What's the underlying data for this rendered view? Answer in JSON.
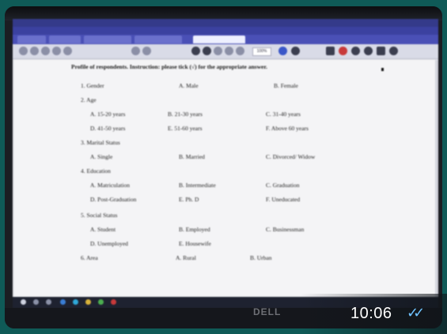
{
  "document": {
    "heading": "Profile of respondents. Instruction: please tick (√) for the appropriate answer.",
    "rows": [
      {
        "label": "1.  Gender",
        "options": [
          "A. Male",
          "B.  Female"
        ]
      },
      {
        "label": "2.  Age",
        "options": []
      },
      {
        "label": "",
        "options": [
          "A.  15-20 years",
          "B.  21-30 years",
          "C.  31-40 years"
        ]
      },
      {
        "label": "",
        "options": [
          "D.  41-50 years",
          "E.  51-60 years",
          "F.  Above 60 years"
        ]
      },
      {
        "label": "3.  Marital Status",
        "options": []
      },
      {
        "label": "",
        "options": [
          "A.  Single",
          "B.  Married",
          "C.  Divorced/ Widow"
        ]
      },
      {
        "label": "4.  Education",
        "options": []
      },
      {
        "label": "",
        "options": [
          "A.  Matriculation",
          "B.  Intermediate",
          "C.  Graduation"
        ]
      },
      {
        "label": "",
        "options": [
          "D.  Post-Graduation",
          "E.  Ph. D",
          "F.  Uneducated"
        ]
      },
      {
        "label": "5.  Social Status",
        "options": []
      },
      {
        "label": "",
        "options": [
          "A.  Student",
          "B.  Employed",
          "C.  Businessman"
        ]
      },
      {
        "label": "",
        "options": [
          "D. Unemployed",
          "E.  Housewife",
          ""
        ]
      },
      {
        "label": "6.  Area",
        "options": [
          "A. Rural",
          "B. Urban"
        ]
      }
    ]
  },
  "toolbar": {
    "zoom": "100%"
  },
  "overlay": {
    "time": "10:06",
    "read_receipt": "✓✓"
  },
  "bezel": {
    "brand": "DELL"
  },
  "colors": {
    "titlebar": "#343a8a",
    "accent_tick": "#6fc3ff"
  }
}
